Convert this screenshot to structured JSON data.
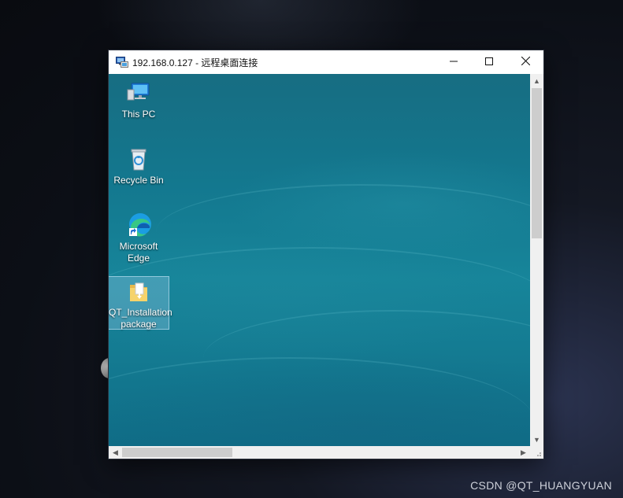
{
  "window": {
    "title": "192.168.0.127 - 远程桌面连接",
    "icons": {
      "app": "remote-desktop-icon",
      "minimize": "minimize-icon",
      "maximize": "maximize-icon",
      "close": "close-icon"
    }
  },
  "remote_desktop": {
    "icons": [
      {
        "label": "This PC",
        "icon": "computer-icon"
      },
      {
        "label": "Recycle Bin",
        "icon": "recycle-bin-icon"
      },
      {
        "label": "Microsoft Edge",
        "icon": "edge-icon"
      },
      {
        "label": "QT_Installation package",
        "icon": "folder-icon",
        "selected": true
      }
    ],
    "wallpaper_color": "#157a90"
  },
  "scrollbars": {
    "vertical": "vertical-scrollbar",
    "horizontal": "horizontal-scrollbar"
  },
  "watermark": "CSDN @QT_HUANGYUAN"
}
